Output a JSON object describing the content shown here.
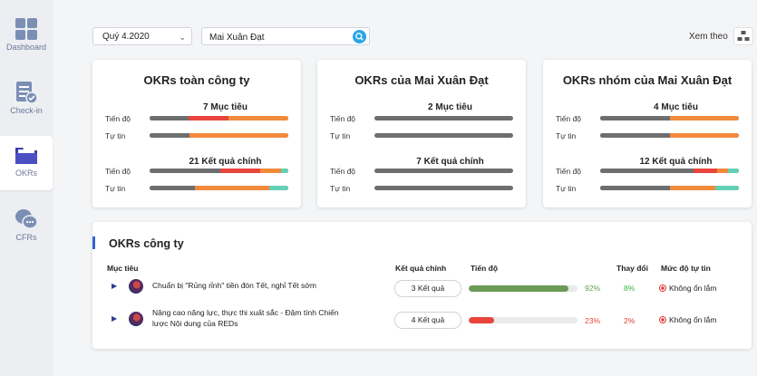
{
  "sidebar": {
    "items": [
      {
        "label": "Dashboard",
        "icon": "dashboard-icon"
      },
      {
        "label": "Check-in",
        "icon": "checkin-icon"
      },
      {
        "label": "OKRs",
        "icon": "folder-icon",
        "active": true
      },
      {
        "label": "CFRs",
        "icon": "chat-icon"
      }
    ]
  },
  "toolbar": {
    "period": "Quý 4.2020",
    "search_value": "Mai Xuân Đạt",
    "view_label": "Xem theo"
  },
  "cards": [
    {
      "title": "OKRs toàn công ty",
      "objectives_label": "7 Mục tiêu",
      "key_results_label": "21 Kết quả chính",
      "row_labels": {
        "progress": "Tiến độ",
        "confidence": "Tự tin"
      }
    },
    {
      "title": "OKRs của Mai Xuân Đạt",
      "objectives_label": "2 Mục tiêu",
      "key_results_label": "7 Kết quả chính",
      "row_labels": {
        "progress": "Tiến độ",
        "confidence": "Tự tin"
      }
    },
    {
      "title": "OKRs nhóm của Mai Xuân Đạt",
      "objectives_label": "4 Mục tiêu",
      "key_results_label": "12 Kết quả chính",
      "row_labels": {
        "progress": "Tiến độ",
        "confidence": "Tự tin"
      }
    }
  ],
  "company_okrs": {
    "title": "OKRs công ty",
    "headers": {
      "objective": "Mục tiêu",
      "key_results": "Kết quả chính",
      "progress": "Tiến độ",
      "change": "Thay đổi",
      "confidence": "Mức độ tự tin"
    },
    "rows": [
      {
        "objective": "Chuẩn bị \"Rủng rỉnh\" tiền đón Tết, nghỉ Tết sớm",
        "key_results": "3 Kết quả",
        "progress": "92%",
        "progress_value": 0.92,
        "progress_color": "#6b9a57",
        "change": "8%",
        "change_color": "#3cb44b",
        "confidence": "Không ổn lắm"
      },
      {
        "objective": "Nâng cao năng lực, thực thi xuất sắc - Đậm tính Chiến lược Nội dung của REDs",
        "key_results": "4 Kết quả",
        "progress": "23%",
        "progress_value": 0.23,
        "progress_color": "#e8453c",
        "change": "2%",
        "change_color": "#e23b3b",
        "confidence": "Không ổn lắm"
      }
    ]
  },
  "colors": {
    "accent": "#3562d6",
    "bar_gray": "#6d6e70",
    "bar_red": "#e8453c",
    "bar_orange": "#f28a3c",
    "bar_teal": "#62d0b4"
  }
}
